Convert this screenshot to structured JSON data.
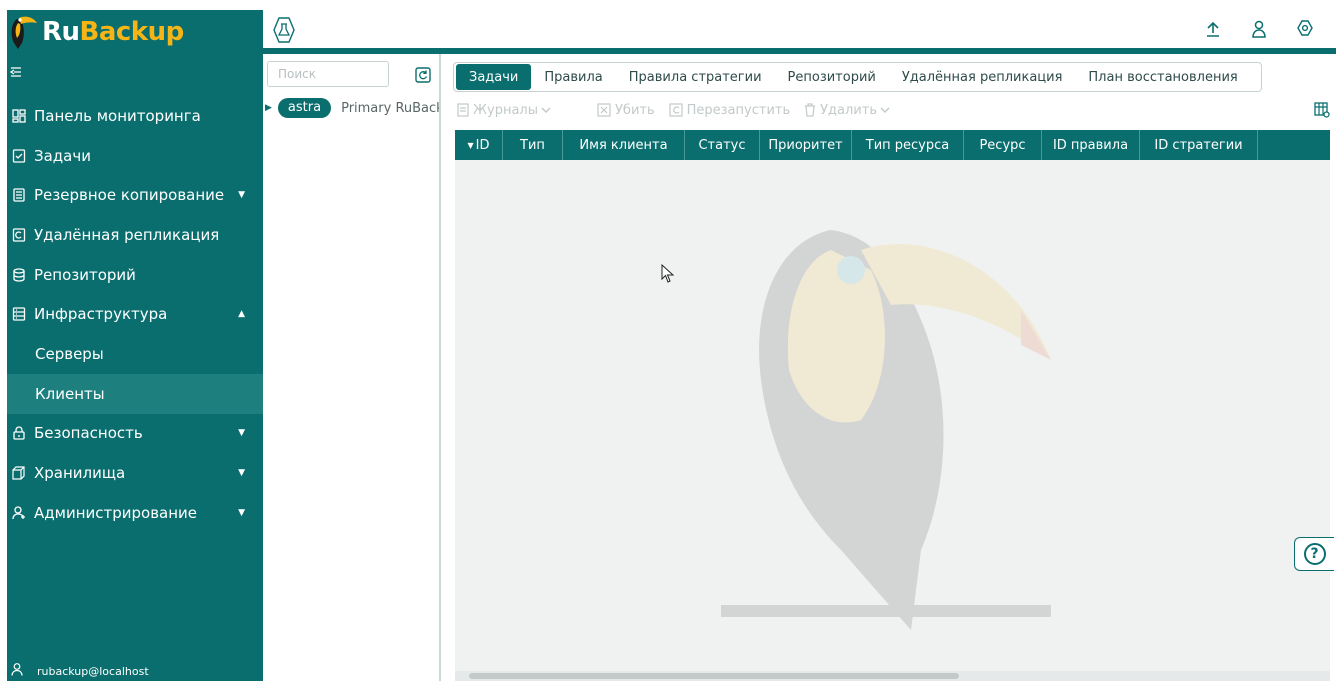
{
  "app": {
    "logo_ru": "Ru",
    "logo_backup": "Backup",
    "collapse_icon": "collapse-menu-icon"
  },
  "sidebar": {
    "items": [
      {
        "label": "Панель мониторинга",
        "icon": "dashboard-icon"
      },
      {
        "label": "Задачи",
        "icon": "tasks-icon"
      },
      {
        "label": "Резервное копирование",
        "icon": "backup-icon",
        "arrow": "▼"
      },
      {
        "label": "Удалённая репликация",
        "icon": "replication-icon"
      },
      {
        "label": "Репозиторий",
        "icon": "database-icon"
      },
      {
        "label": "Инфраструктура",
        "icon": "infrastructure-icon",
        "arrow": "▲"
      },
      {
        "label": "Серверы"
      },
      {
        "label": "Клиенты"
      },
      {
        "label": "Безопасность",
        "icon": "lock-icon",
        "arrow": "▼"
      },
      {
        "label": "Хранилища",
        "icon": "storage-icon",
        "arrow": "▼"
      },
      {
        "label": "Администрирование",
        "icon": "admin-icon",
        "arrow": "▼"
      }
    ],
    "user": "rubackup@localhost"
  },
  "tree": {
    "search_placeholder": "Поиск",
    "badge": "astra",
    "description": "Primary RuBackup server"
  },
  "tabs": [
    "Задачи",
    "Правила",
    "Правила стратегии",
    "Репозиторий",
    "Удалённая репликация",
    "План восстановления"
  ],
  "toolbar": {
    "journals": "Журналы",
    "kill": "Убить",
    "restart": "Перезапустить",
    "delete": "Удалить"
  },
  "grid": {
    "columns": [
      {
        "label": "ID",
        "sort": "▼"
      },
      {
        "label": "Тип"
      },
      {
        "label": "Имя клиента"
      },
      {
        "label": "Статус"
      },
      {
        "label": "Приоритет"
      },
      {
        "label": "Тип ресурса"
      },
      {
        "label": "Ресурс"
      },
      {
        "label": "ID правила"
      },
      {
        "label": "ID стратегии"
      }
    ]
  },
  "help": {
    "label": "?"
  },
  "colors": {
    "brand": "#0b6e6e",
    "accent": "#f6b516",
    "active_item": "#1e7f7f"
  }
}
